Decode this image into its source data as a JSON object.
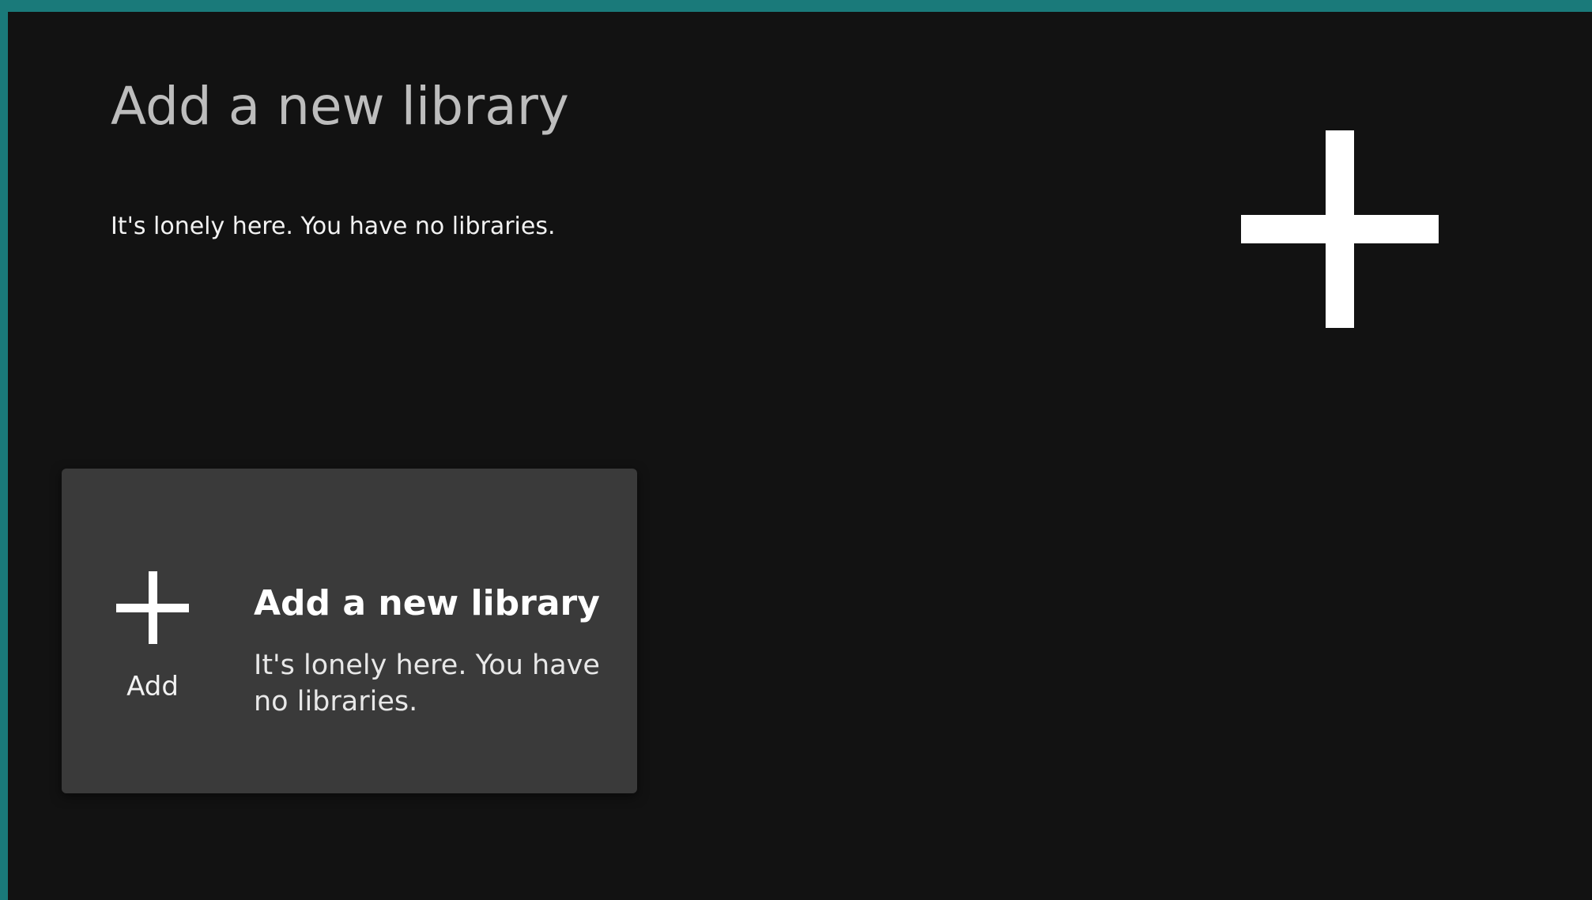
{
  "page": {
    "title": "Add a new library",
    "subtitle": "It's lonely here. You have no libraries.",
    "accent_color": "#1a7a7a",
    "background_color": "#121212"
  },
  "hero_icon": {
    "icon": "plus-icon"
  },
  "card": {
    "action_icon": "plus-icon",
    "action_label": "Add",
    "title": "Add a new library",
    "body": "It's lonely here. You have no libraries.",
    "background_color": "#3a3a3a"
  }
}
